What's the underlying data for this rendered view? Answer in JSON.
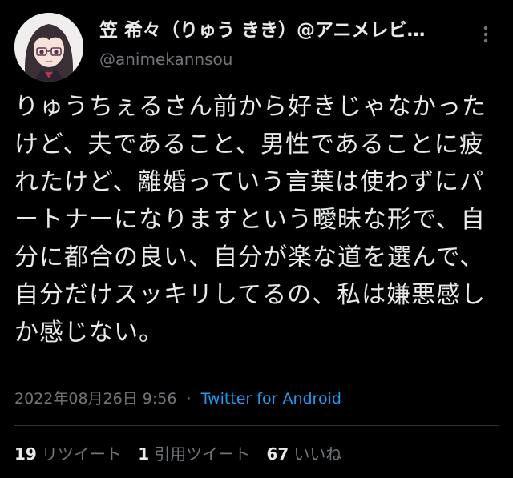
{
  "author": {
    "display_name": "笠 希々（りゅう きき）@アニメレビ…",
    "handle": "@animekannsou",
    "avatar_icon": "user-avatar-icon"
  },
  "more_icon": "more-vertical-icon",
  "tweet": {
    "text": "りゅうちぇるさん前から好きじゃなかったけど、夫であること、男性であることに疲れたけど、離婚っていう言葉は使わずにパートナーになりますという曖昧な形で、自分に都合の良い、自分が楽な道を選んで、自分だけスッキリしてるの、私は嫌悪感しか感じない。",
    "date": "2022年08月26日 9:56",
    "separator": "·",
    "source": "Twitter for Android"
  },
  "stats": [
    {
      "count": "19",
      "label": "リツイート"
    },
    {
      "count": "1",
      "label": "引用ツイート"
    },
    {
      "count": "67",
      "label": "いいね"
    }
  ],
  "colors": {
    "background": "#000000",
    "text": "#e7e9ea",
    "muted": "#71767b",
    "link": "#1d9bf0",
    "divider": "#2f3336"
  }
}
